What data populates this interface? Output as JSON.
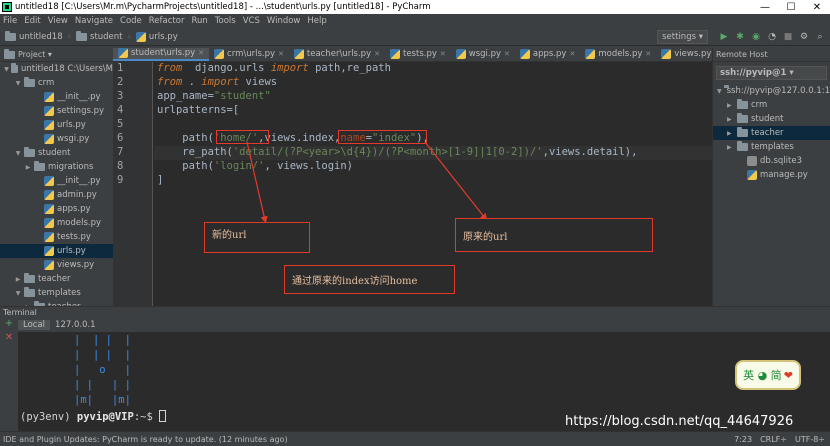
{
  "window": {
    "title": "untitled18 [C:\\Users\\Mr.m\\PycharmProjects\\untitled18] - ...\\student\\urls.py [untitled18] - PyCharm",
    "min": "—",
    "max": "☐",
    "close": "✕"
  },
  "menu": [
    "File",
    "Edit",
    "View",
    "Navigate",
    "Code",
    "Refactor",
    "Run",
    "Tools",
    "VCS",
    "Window",
    "Help"
  ],
  "breadcrumbs": [
    "untitled18",
    "student",
    "urls.py"
  ],
  "toolbar": {
    "run_config": "settings ▾"
  },
  "project_panel": {
    "header": "Project ▾",
    "tree": [
      {
        "label": "untitled18  C:\\Users\\M",
        "arrow": "▼",
        "indent": 0,
        "type": "folder"
      },
      {
        "label": "crm",
        "arrow": "▼",
        "indent": 1,
        "type": "folder"
      },
      {
        "label": "__init__.py",
        "arrow": "",
        "indent": 3,
        "type": "py"
      },
      {
        "label": "settings.py",
        "arrow": "",
        "indent": 3,
        "type": "py"
      },
      {
        "label": "urls.py",
        "arrow": "",
        "indent": 3,
        "type": "py"
      },
      {
        "label": "wsgi.py",
        "arrow": "",
        "indent": 3,
        "type": "py"
      },
      {
        "label": "student",
        "arrow": "▼",
        "indent": 1,
        "type": "folder"
      },
      {
        "label": "migrations",
        "arrow": "▶",
        "indent": 2,
        "type": "folder"
      },
      {
        "label": "__init__.py",
        "arrow": "",
        "indent": 3,
        "type": "py"
      },
      {
        "label": "admin.py",
        "arrow": "",
        "indent": 3,
        "type": "py"
      },
      {
        "label": "apps.py",
        "arrow": "",
        "indent": 3,
        "type": "py"
      },
      {
        "label": "models.py",
        "arrow": "",
        "indent": 3,
        "type": "py"
      },
      {
        "label": "tests.py",
        "arrow": "",
        "indent": 3,
        "type": "py"
      },
      {
        "label": "urls.py",
        "arrow": "",
        "indent": 3,
        "type": "py",
        "selected": true
      },
      {
        "label": "views.py",
        "arrow": "",
        "indent": 3,
        "type": "py"
      },
      {
        "label": "teacher",
        "arrow": "▶",
        "indent": 1,
        "type": "folder"
      },
      {
        "label": "templates",
        "arrow": "▼",
        "indent": 1,
        "type": "folder"
      },
      {
        "label": "teacher",
        "arrow": "▶",
        "indent": 2,
        "type": "folder"
      }
    ]
  },
  "tabs": [
    {
      "label": "student\\urls.py",
      "active": true
    },
    {
      "label": "crm\\urls.py",
      "active": false
    },
    {
      "label": "teacher\\urls.py",
      "active": false
    },
    {
      "label": "tests.py",
      "active": false
    },
    {
      "label": "wsgi.py",
      "active": false
    },
    {
      "label": "apps.py",
      "active": false
    },
    {
      "label": "models.py",
      "active": false
    },
    {
      "label": "views.py",
      "active": false
    }
  ],
  "editor": {
    "line_numbers": [
      "1",
      "2",
      "3",
      "4",
      "5",
      "6",
      "7",
      "8",
      "9"
    ],
    "lines": [
      "from  django.urls import path,re_path",
      "from . import views",
      "app_name=\"student\"",
      "urlpatterns=[",
      "",
      "    path('home/',views.index,name=\"index\"),",
      "    re_path('detail/(?P<year>\\d{4})/(?P<month>[1-9]|1[0-2])/',views.detail),",
      "    path('login/', views.login)",
      "]"
    ]
  },
  "annotations": {
    "new_url": "新的url",
    "old_url": "原来的url",
    "access_home": "通过原来的index访问home"
  },
  "remote_host": {
    "title": "Remote Host",
    "combo": "ssh://pyvip@1 ▾",
    "items": [
      {
        "label": "ssh://pyvip@127.0.0.1:1",
        "arrow": "▼",
        "indent": 0,
        "type": "folder"
      },
      {
        "label": "crm",
        "arrow": "▶",
        "indent": 1,
        "type": "folder"
      },
      {
        "label": "student",
        "arrow": "▶",
        "indent": 1,
        "type": "folder"
      },
      {
        "label": "teacher",
        "arrow": "▶",
        "indent": 1,
        "type": "folder",
        "selected": true
      },
      {
        "label": "templates",
        "arrow": "▶",
        "indent": 1,
        "type": "folder"
      },
      {
        "label": "db.sqlite3",
        "arrow": "",
        "indent": 2,
        "type": "file"
      },
      {
        "label": "manage.py",
        "arrow": "",
        "indent": 2,
        "type": "py"
      }
    ]
  },
  "terminal": {
    "header": "Terminal",
    "tabs": [
      "Local",
      "127.0.0.1"
    ],
    "art": [
      "|  | |  |",
      "|  | |  |",
      "|   o   |",
      "| |   | |",
      "|m|   |m|"
    ],
    "prompt_env": "(py3env) ",
    "prompt_user": "pyvip@VIP",
    "prompt_rest": ":~$ "
  },
  "badge": {
    "text": "英 ◕ 简",
    "heart": "❤"
  },
  "watermark": "https://blog.csdn.net/qq_44647926",
  "status": {
    "message": "IDE and Plugin Updates: PyCharm is ready to update. (12 minutes ago)",
    "position": "7:23",
    "line_sep": "CRLF÷",
    "encoding": "UTF-8÷"
  }
}
